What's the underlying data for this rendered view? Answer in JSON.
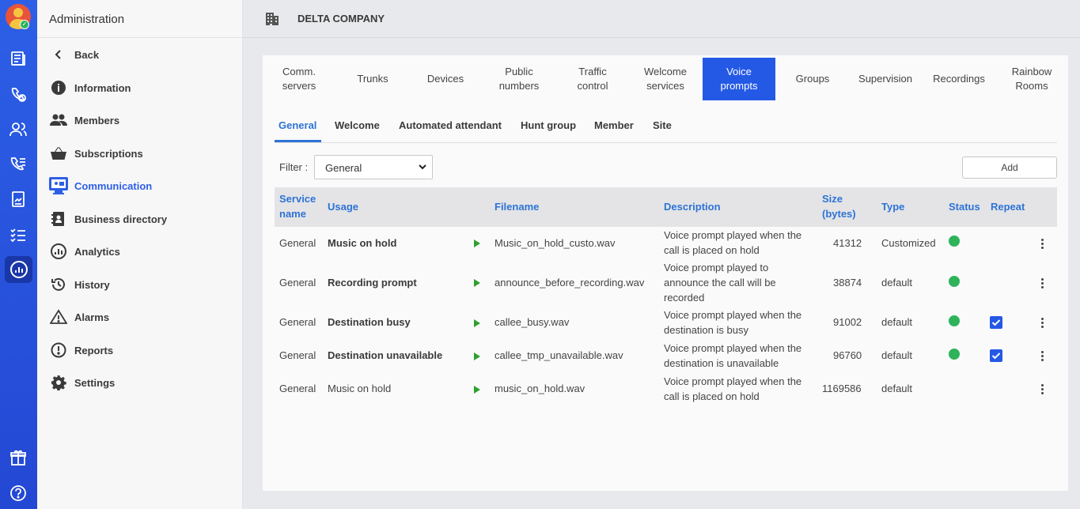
{
  "sidebar": {
    "title": "Administration",
    "items": [
      {
        "label": "Back",
        "icon": "chevron-left-icon"
      },
      {
        "label": "Information",
        "icon": "info-icon"
      },
      {
        "label": "Members",
        "icon": "people-icon"
      },
      {
        "label": "Subscriptions",
        "icon": "basket-icon"
      },
      {
        "label": "Communication",
        "icon": "communication-icon",
        "active": true
      },
      {
        "label": "Business directory",
        "icon": "contacts-book-icon"
      },
      {
        "label": "Analytics",
        "icon": "analytics-icon"
      },
      {
        "label": "History",
        "icon": "history-icon"
      },
      {
        "label": "Alarms",
        "icon": "warning-icon"
      },
      {
        "label": "Reports",
        "icon": "report-icon"
      },
      {
        "label": "Settings",
        "icon": "gear-icon"
      }
    ]
  },
  "header": {
    "company": "DELTA COMPANY"
  },
  "tabs": [
    {
      "label": "Comm.\nservers"
    },
    {
      "label": "Trunks"
    },
    {
      "label": "Devices"
    },
    {
      "label": "Public\nnumbers"
    },
    {
      "label": "Traffic\ncontrol"
    },
    {
      "label": "Welcome\nservices"
    },
    {
      "label": "Voice\nprompts",
      "active": true
    },
    {
      "label": "Groups"
    },
    {
      "label": "Supervision"
    },
    {
      "label": "Recordings"
    },
    {
      "label": "Rainbow\nRooms"
    }
  ],
  "subtabs": [
    {
      "label": "General",
      "active": true
    },
    {
      "label": "Welcome"
    },
    {
      "label": "Automated attendant"
    },
    {
      "label": "Hunt group"
    },
    {
      "label": "Member"
    },
    {
      "label": "Site"
    }
  ],
  "filter": {
    "label": "Filter :",
    "value": "General"
  },
  "add_label": "Add",
  "table": {
    "headers": {
      "service": "Service\nname",
      "usage": "Usage",
      "filename": "Filename",
      "description": "Description",
      "size": "Size\n(bytes)",
      "type": "Type",
      "status": "Status",
      "repeat": "Repeat"
    },
    "rows": [
      {
        "service": "General",
        "usage": "Music on hold",
        "usage_bold": true,
        "filename": "Music_on_hold_custo.wav",
        "description": "Voice prompt played when the\ncall is placed on hold",
        "size": "41312",
        "type": "Customized",
        "status": true,
        "repeat": false
      },
      {
        "service": "General",
        "usage": "Recording prompt",
        "usage_bold": true,
        "filename": "announce_before_recording.wav",
        "description": "Voice prompt played to\nannounce the call will be\nrecorded",
        "size": "38874",
        "type": "default",
        "status": true,
        "repeat": false
      },
      {
        "service": "General",
        "usage": "Destination busy",
        "usage_bold": true,
        "filename": "callee_busy.wav",
        "description": "Voice prompt played when the\ndestination is busy",
        "size": "91002",
        "type": "default",
        "status": true,
        "repeat": true
      },
      {
        "service": "General",
        "usage": "Destination unavailable",
        "usage_bold": true,
        "filename": "callee_tmp_unavailable.wav",
        "description": "Voice prompt played when the\ndestination is unavailable",
        "size": "96760",
        "type": "default",
        "status": true,
        "repeat": true
      },
      {
        "service": "General",
        "usage": "Music on hold",
        "usage_bold": false,
        "filename": "music_on_hold.wav",
        "description": "Voice prompt played when the\ncall is placed on hold",
        "size": "1169586",
        "type": "default",
        "status": false,
        "repeat": false
      }
    ]
  },
  "colors": {
    "accent": "#2459e6",
    "link": "#2d73d6",
    "ok": "#2eb35a",
    "rail": "#2d5fe6"
  }
}
